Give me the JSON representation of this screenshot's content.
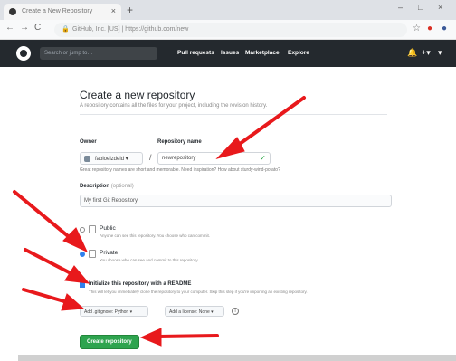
{
  "browser": {
    "tab_title": "Create a New Repository",
    "tab_close": "×",
    "new_tab": "+",
    "window_controls": [
      "–",
      "□",
      "×"
    ],
    "nav": [
      "←",
      "→",
      "C"
    ],
    "lock": "🔒",
    "url": "GitHub, Inc. [US]  |  https://github.com/new",
    "extensions": [
      "☆",
      "●",
      "●"
    ]
  },
  "header": {
    "search_placeholder": "Search or jump to…",
    "nav_items": [
      "Pull requests",
      "Issues",
      "Marketplace",
      "Explore"
    ],
    "right_icons": [
      "🔔",
      "+▾",
      "▾"
    ]
  },
  "form": {
    "title": "Create a new repository",
    "subtitle": "A repository contains all the files for your project, including the revision history.",
    "owner_label": "Owner",
    "owner_value": "fabioelzdeld ▾",
    "slash": "/",
    "repo_label": "Repository name",
    "repo_value": "newrepository",
    "repo_check": "✓",
    "hint": "Great repository names are short and memorable. Need inspiration? How about sturdy-wind-potato?",
    "description_label": "Description",
    "description_optional": "(optional)",
    "description_value": "My first Git Repository",
    "public_label": "Public",
    "public_desc": "Anyone can see this repository. You choose who can commit.",
    "private_label": "Private",
    "private_desc": "You choose who can see and commit to this repository.",
    "readme_label": "Initialize this repository with a README",
    "readme_desc": "This will let you immediately clone the repository to your computer. Skip this step if you're importing an existing repository.",
    "gitignore_label": "Add .gitignore: Python ▾",
    "license_label": "Add a license: None ▾",
    "info": "i",
    "create_label": "Create repository"
  }
}
